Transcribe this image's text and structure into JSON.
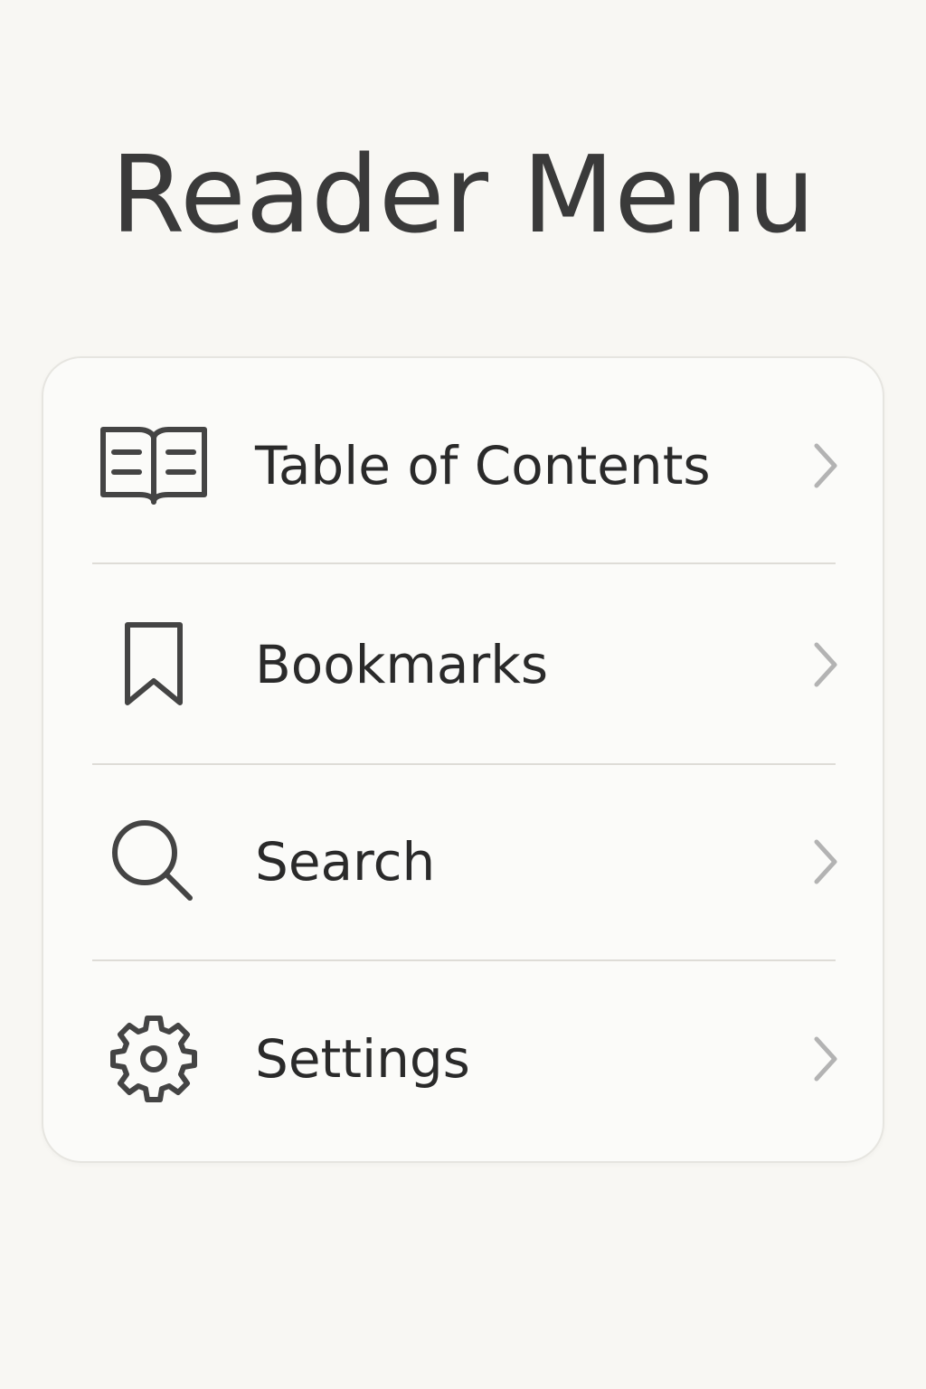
{
  "page": {
    "title": "Reader Menu"
  },
  "menu": {
    "items": [
      {
        "label": "Table of Contents",
        "icon": "open-book-icon"
      },
      {
        "label": "Bookmarks",
        "icon": "bookmark-icon"
      },
      {
        "label": "Search",
        "icon": "search-icon"
      },
      {
        "label": "Settings",
        "icon": "gear-icon"
      }
    ],
    "chevron_icon": "chevron-right-icon"
  },
  "colors": {
    "background": "#f8f7f3",
    "card": "#fbfbf9",
    "text": "#2a2a2a",
    "icon": "#444444",
    "chevron": "#b3b3b3",
    "divider": "#dedcd7"
  }
}
